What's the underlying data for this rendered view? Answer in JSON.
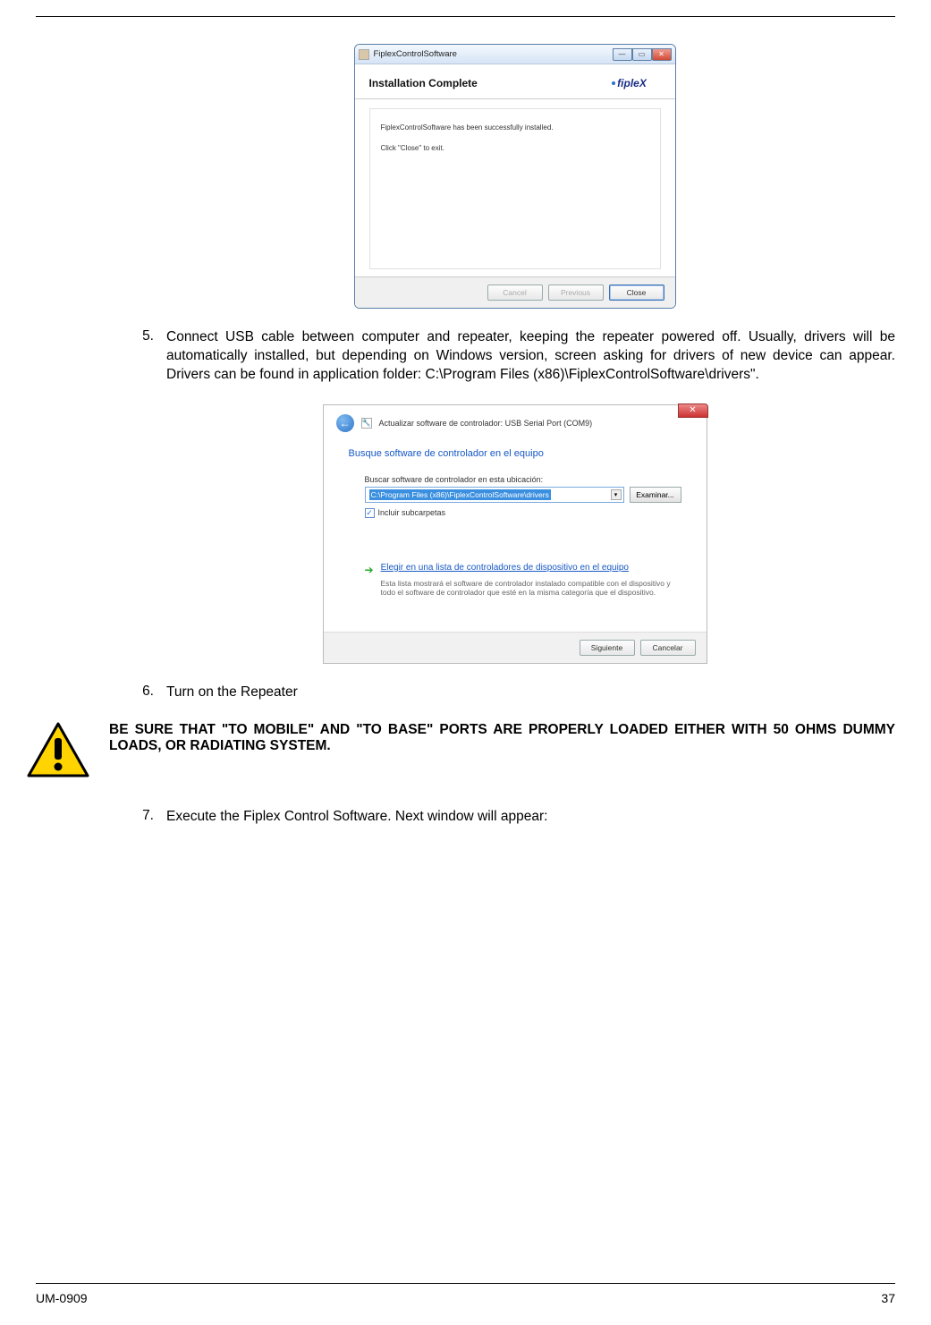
{
  "dialog1": {
    "titlebar": "FiplexControlSoftware",
    "heading": "Installation Complete",
    "logo_text": "fipleX",
    "line1": "FiplexControlSoftware has been successfully installed.",
    "line2": "Click \"Close\" to exit.",
    "buttons": {
      "cancel": "Cancel",
      "previous": "Previous",
      "close": "Close"
    }
  },
  "item5": {
    "num": "5.",
    "text": "Connect USB cable between computer and repeater, keeping the repeater powered off. Usually, drivers will be automatically installed, but depending on Windows version, screen asking for drivers of new device can appear. Drivers can be found in application folder: C:\\Program Files (x86)\\FiplexControlSoftware\\drivers\"."
  },
  "dialog2": {
    "header_text": "Actualizar software de controlador: USB Serial Port (COM9)",
    "title": "Busque software de controlador en el equipo",
    "search_label": "Buscar software de controlador en esta ubicación:",
    "path": "C:\\Program Files (x86)\\FiplexControlSoftware\\drivers",
    "browse": "Examinar...",
    "include_sub": "Incluir subcarpetas",
    "option_link": "Elegir en una lista de controladores de dispositivo en el equipo",
    "option_desc": "Esta lista mostrará el software de controlador instalado compatible con el dispositivo y todo el software de controlador que esté en la misma categoría que el dispositivo.",
    "next": "Siguiente",
    "cancel": "Cancelar"
  },
  "item6": {
    "num": "6.",
    "text": "Turn on the Repeater"
  },
  "warning": {
    "text": "BE SURE THAT \"TO MOBILE\" AND \"TO BASE\" PORTS ARE PROPERLY LOADED EITHER WITH 50 OHMS DUMMY LOADS, OR RADIATING SYSTEM."
  },
  "item7": {
    "num": "7.",
    "text": "Execute the Fiplex Control Software. Next window will appear:"
  },
  "footer": {
    "left": "UM-0909",
    "right": "37"
  }
}
